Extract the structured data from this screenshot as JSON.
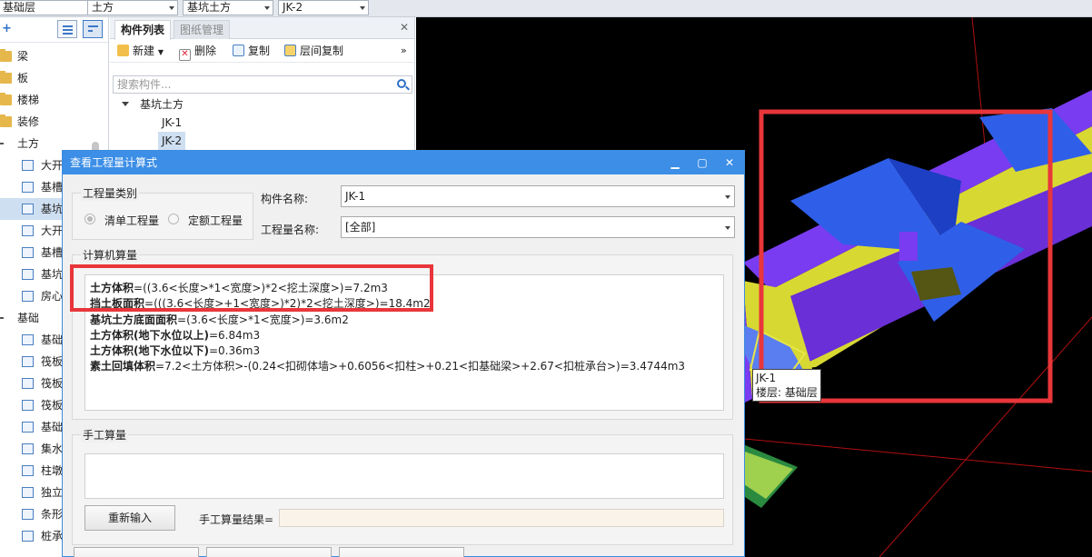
{
  "toolbar": {
    "floor": "基础层",
    "category": "土方",
    "type": "基坑土方",
    "component": "JK-2"
  },
  "leftnav": {
    "items": [
      {
        "label": "梁",
        "kind": "folder"
      },
      {
        "label": "板",
        "kind": "folder"
      },
      {
        "label": "楼梯",
        "kind": "folder"
      },
      {
        "label": "装修",
        "kind": "folder"
      },
      {
        "label": "土方",
        "kind": "folder-open"
      },
      {
        "label": "大开",
        "kind": "comp"
      },
      {
        "label": "基槽",
        "kind": "comp"
      },
      {
        "label": "基坑",
        "kind": "comp-selected"
      },
      {
        "label": "大开",
        "kind": "comp"
      },
      {
        "label": "基槽",
        "kind": "comp"
      },
      {
        "label": "基坑",
        "kind": "comp"
      },
      {
        "label": "房心",
        "kind": "comp"
      },
      {
        "label": "基础",
        "kind": "folder-open"
      },
      {
        "label": "基础",
        "kind": "comp"
      },
      {
        "label": "筏板",
        "kind": "comp"
      },
      {
        "label": "筏板",
        "kind": "comp"
      },
      {
        "label": "筏板",
        "kind": "comp"
      },
      {
        "label": "基础",
        "kind": "comp"
      },
      {
        "label": "集水",
        "kind": "comp"
      },
      {
        "label": "柱墩",
        "kind": "comp"
      },
      {
        "label": "独立",
        "kind": "comp"
      },
      {
        "label": "条形",
        "kind": "comp"
      },
      {
        "label": "桩承",
        "kind": "comp"
      }
    ]
  },
  "comppanel": {
    "tab_active": "构件列表",
    "tab_inactive": "图纸管理",
    "btn_new": "新建",
    "btn_delete": "删除",
    "btn_copy": "复制",
    "btn_floor_copy": "层间复制",
    "more": "»",
    "search_placeholder": "搜索构件...",
    "tree_root": "基坑土方",
    "tree_items": [
      "JK-1",
      "JK-2"
    ]
  },
  "viewport": {
    "tooltip_name": "JK-1",
    "tooltip_floor": "楼层: 基础层"
  },
  "dialog": {
    "title": "查看工程量计算式",
    "group_type_label": "工程量类别",
    "radio_list": "清单工程量",
    "radio_quota": "定额工程量",
    "comp_name_label": "构件名称:",
    "comp_name_value": "JK-1",
    "qty_name_label": "工程量名称:",
    "qty_name_value": "[全部]",
    "calc_section": "计算机算量",
    "formulas": [
      {
        "name": "土方体积",
        "expr": "=((3.6<长度>*1<宽度>)*2<挖土深度>)=7.2m3"
      },
      {
        "name": "挡土板面积",
        "expr": "=(((3.6<长度>+1<宽度>)*2)*2<挖土深度>)=18.4m2"
      },
      {
        "name": "基坑土方底面面积",
        "expr": "=(3.6<长度>*1<宽度>)=3.6m2"
      },
      {
        "name": "土方体积(地下水位以上)",
        "expr": "=6.84m3"
      },
      {
        "name": "土方体积(地下水位以下)",
        "expr": "=0.36m3"
      },
      {
        "name": "素土回填体积",
        "expr": "=7.2<土方体积>-(0.24<扣砌体墙>+0.6056<扣柱>+0.21<扣基础梁>+2.67<扣桩承台>)=3.4744m3"
      }
    ],
    "manual_section": "手工算量",
    "reenter_button": "重新输入",
    "manual_result_label": "手工算量结果="
  },
  "colors": {
    "accent": "#3c8ee6",
    "highlight": "#e8363a"
  }
}
